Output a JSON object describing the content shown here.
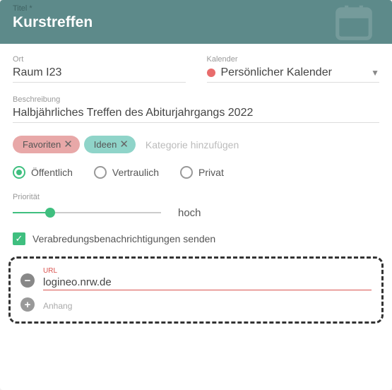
{
  "header": {
    "title_label": "Titel *",
    "title": "Kurstreffen"
  },
  "ort": {
    "label": "Ort",
    "value": "Raum I23"
  },
  "kalender": {
    "label": "Kalender",
    "value": "Persönlicher Kalender",
    "color": "#e86c6c"
  },
  "beschreibung": {
    "label": "Beschreibung",
    "value": "Halbjährliches Treffen des Abiturjahrgangs 2022"
  },
  "chips": [
    {
      "label": "Favoriten"
    },
    {
      "label": "Ideen"
    }
  ],
  "add_category": "Kategorie hinzufügen",
  "visibility": {
    "options": [
      {
        "label": "Öffentlich",
        "selected": true
      },
      {
        "label": "Vertraulich",
        "selected": false
      },
      {
        "label": "Privat",
        "selected": false
      }
    ]
  },
  "prio": {
    "label": "Priorität",
    "text": "hoch"
  },
  "notify": {
    "label": "Verabredungsbenachrichtigungen senden"
  },
  "url": {
    "label": "URL",
    "value": "logineo.nrw.de"
  },
  "attach": {
    "label": "Anhang"
  }
}
